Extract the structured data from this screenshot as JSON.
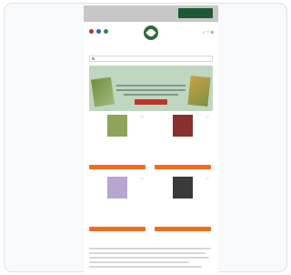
{
  "topbar": {
    "promo": ""
  },
  "header": {
    "logo_text": "",
    "icons": "✓ ♡ ☰",
    "flags": [
      "#cc2b2b",
      "#2e5fb0",
      "#2e8b3e"
    ]
  },
  "search": {
    "placeholder": ""
  },
  "hero": {
    "title": "",
    "subtitle": "",
    "button": ""
  },
  "products": [
    {
      "name": "",
      "price": "",
      "note": "",
      "button": "",
      "img_color": "#8da45a"
    },
    {
      "name": "",
      "price": "",
      "note": "",
      "button": "",
      "img_color": "#8b2e2e"
    },
    {
      "name": "",
      "price": "",
      "note": "",
      "button": "",
      "img_color": "#b7a6cf"
    },
    {
      "name": "",
      "price": "",
      "note": "",
      "button": "",
      "img_color": "#3a3a3a"
    }
  ],
  "section": {
    "title": ""
  },
  "colors": {
    "brand_green": "#2f6b3c",
    "cta_orange": "#ef6c1f",
    "hero_red": "#c1352b"
  }
}
